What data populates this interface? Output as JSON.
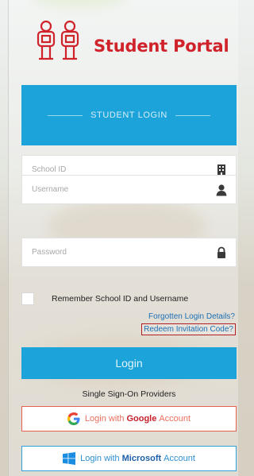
{
  "brand": {
    "name": "Student Portal"
  },
  "login_header": {
    "title": "STUDENT LOGIN"
  },
  "fields": {
    "school_id": {
      "placeholder": "School ID",
      "value": ""
    },
    "username": {
      "placeholder": "Username",
      "value": ""
    },
    "password": {
      "placeholder": "Password",
      "value": ""
    }
  },
  "remember": {
    "label": "Remember School ID and Username",
    "checked": false
  },
  "links": {
    "forgot": "Forgotten Login Details?",
    "redeem": "Redeem Invitation Code?"
  },
  "login_button": {
    "label": "Login"
  },
  "sso": {
    "title": "Single Sign-On Providers",
    "google": {
      "prefix": "Login with",
      "provider": "Google",
      "suffix": "Account"
    },
    "microsoft": {
      "prefix": "Login with",
      "provider": "Microsoft",
      "suffix": "Account"
    }
  },
  "colors": {
    "primary": "#1ba3da",
    "brand_red": "#d0222b",
    "link": "#1b6fb5",
    "google_border": "#e5604f",
    "microsoft_border": "#2ea2d8"
  },
  "icons": {
    "school_id": "building-icon",
    "username": "user-icon",
    "password": "lock-icon"
  }
}
